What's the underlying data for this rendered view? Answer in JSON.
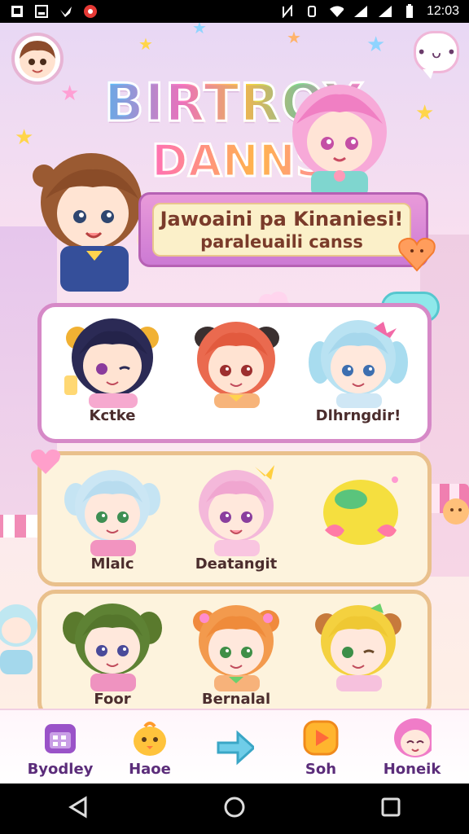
{
  "status_bar": {
    "time": "12:03",
    "left_icons": [
      "gallery-icon",
      "image-icon",
      "bird-icon",
      "record-icon"
    ],
    "right_icons": [
      "nfc-icon",
      "vibrate-icon",
      "wifi-icon",
      "signal-icon",
      "signal2-icon",
      "battery-icon"
    ]
  },
  "header": {
    "logo_line1": "BIRTROY",
    "logo_line2": "DANNSA",
    "banner_line1": "Jawoaini pa Kinaniesi!",
    "banner_line2": "paraleuaili canss"
  },
  "characters": {
    "row1": [
      "Kctke",
      "",
      "Dlhrngdir!"
    ],
    "row2": [
      "Mlalc",
      "Deatangit",
      ""
    ],
    "row3": [
      "Foor",
      "Bernalal",
      ""
    ]
  },
  "cloud_chip_label": "ooo",
  "bottom_nav": {
    "items": [
      {
        "label": "Byodley",
        "icon": "calendar-icon"
      },
      {
        "label": "Haoe",
        "icon": "chick-icon"
      },
      {
        "label": "",
        "icon": "arrow-icon"
      },
      {
        "label": "Soh",
        "icon": "play-icon"
      },
      {
        "label": "Honeik",
        "icon": "profile-icon"
      }
    ]
  },
  "colors": {
    "accent_pink": "#d689c7",
    "panel_gold": "#e9c08c",
    "banner_purple": "#cc7ad4"
  }
}
